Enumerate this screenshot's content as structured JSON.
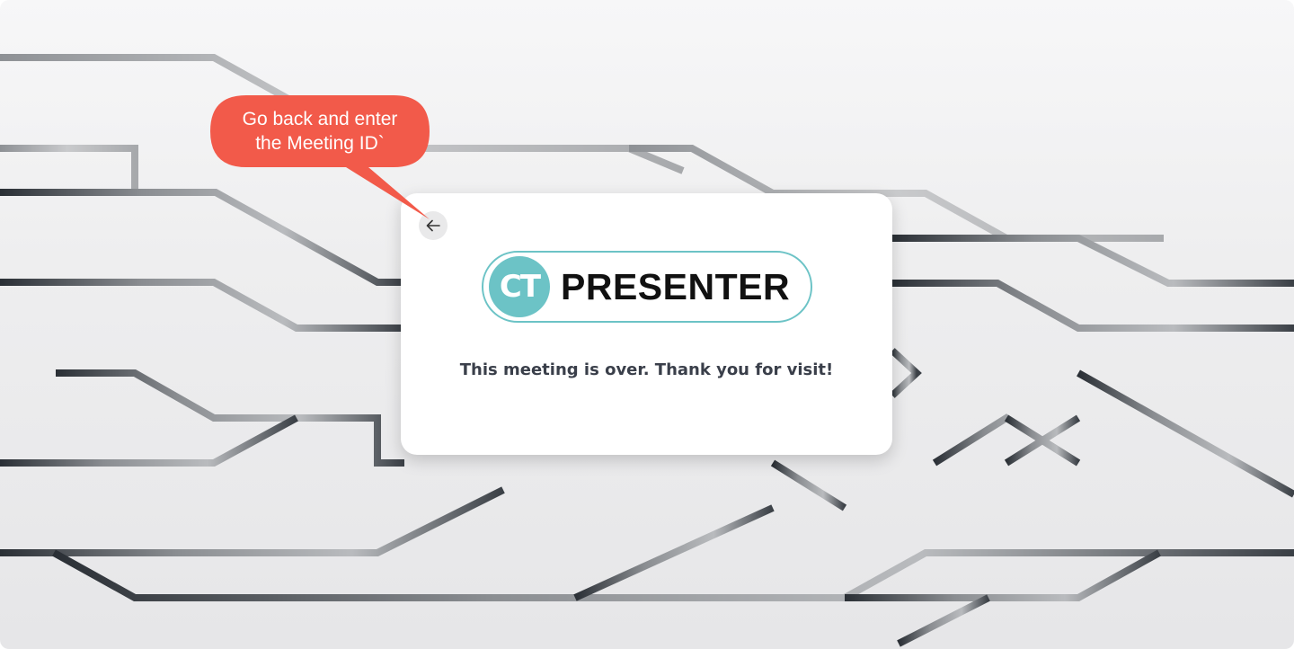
{
  "annotation": {
    "line1": "Go back and enter",
    "line2": "the Meeting ID`",
    "color": "#f25a4a"
  },
  "card": {
    "back_icon": "arrow-left-icon",
    "logo": {
      "mark": "CT",
      "word": "PRESENTER",
      "accent": "#6cc3c6"
    },
    "message": "This meeting is over. Thank you for visit!"
  }
}
